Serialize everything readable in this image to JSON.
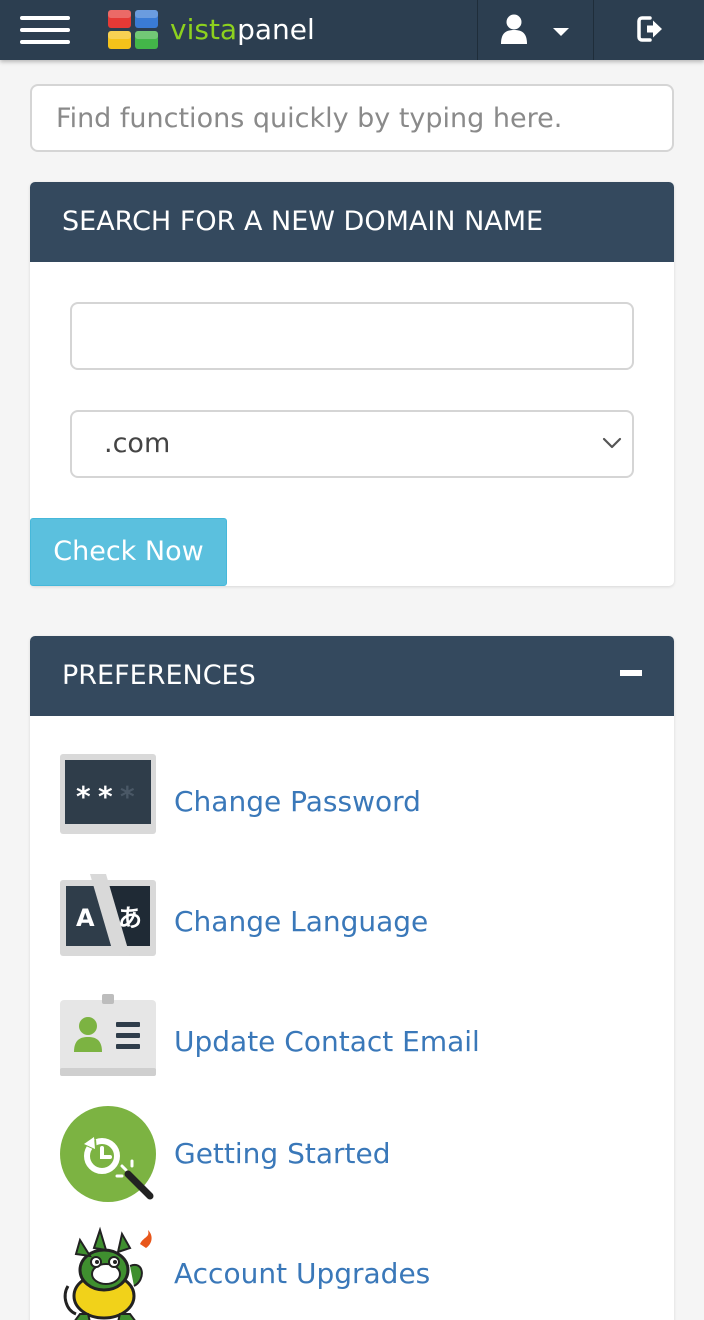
{
  "brand": {
    "name_a": "vista",
    "name_b": "panel"
  },
  "quick_search": {
    "placeholder": "Find functions quickly by typing here."
  },
  "domain_panel": {
    "title": "SEARCH FOR A NEW DOMAIN NAME",
    "domain_value": "",
    "tld_selected": ".com",
    "check_label": "Check Now"
  },
  "preferences": {
    "title": "PREFERENCES",
    "items": [
      {
        "label": "Change Password",
        "icon": "password-icon"
      },
      {
        "label": "Change Language",
        "icon": "language-icon"
      },
      {
        "label": "Update Contact Email",
        "icon": "contact-card-icon"
      },
      {
        "label": "Getting Started",
        "icon": "getting-started-icon"
      },
      {
        "label": "Account Upgrades",
        "icon": "dragon-mascot-icon"
      }
    ]
  },
  "colors": {
    "topbar": "#2c3e50",
    "panel_header": "#34495e",
    "link": "#3a78b9",
    "button_info": "#5bc0de",
    "brand_green": "#8dd11e"
  }
}
